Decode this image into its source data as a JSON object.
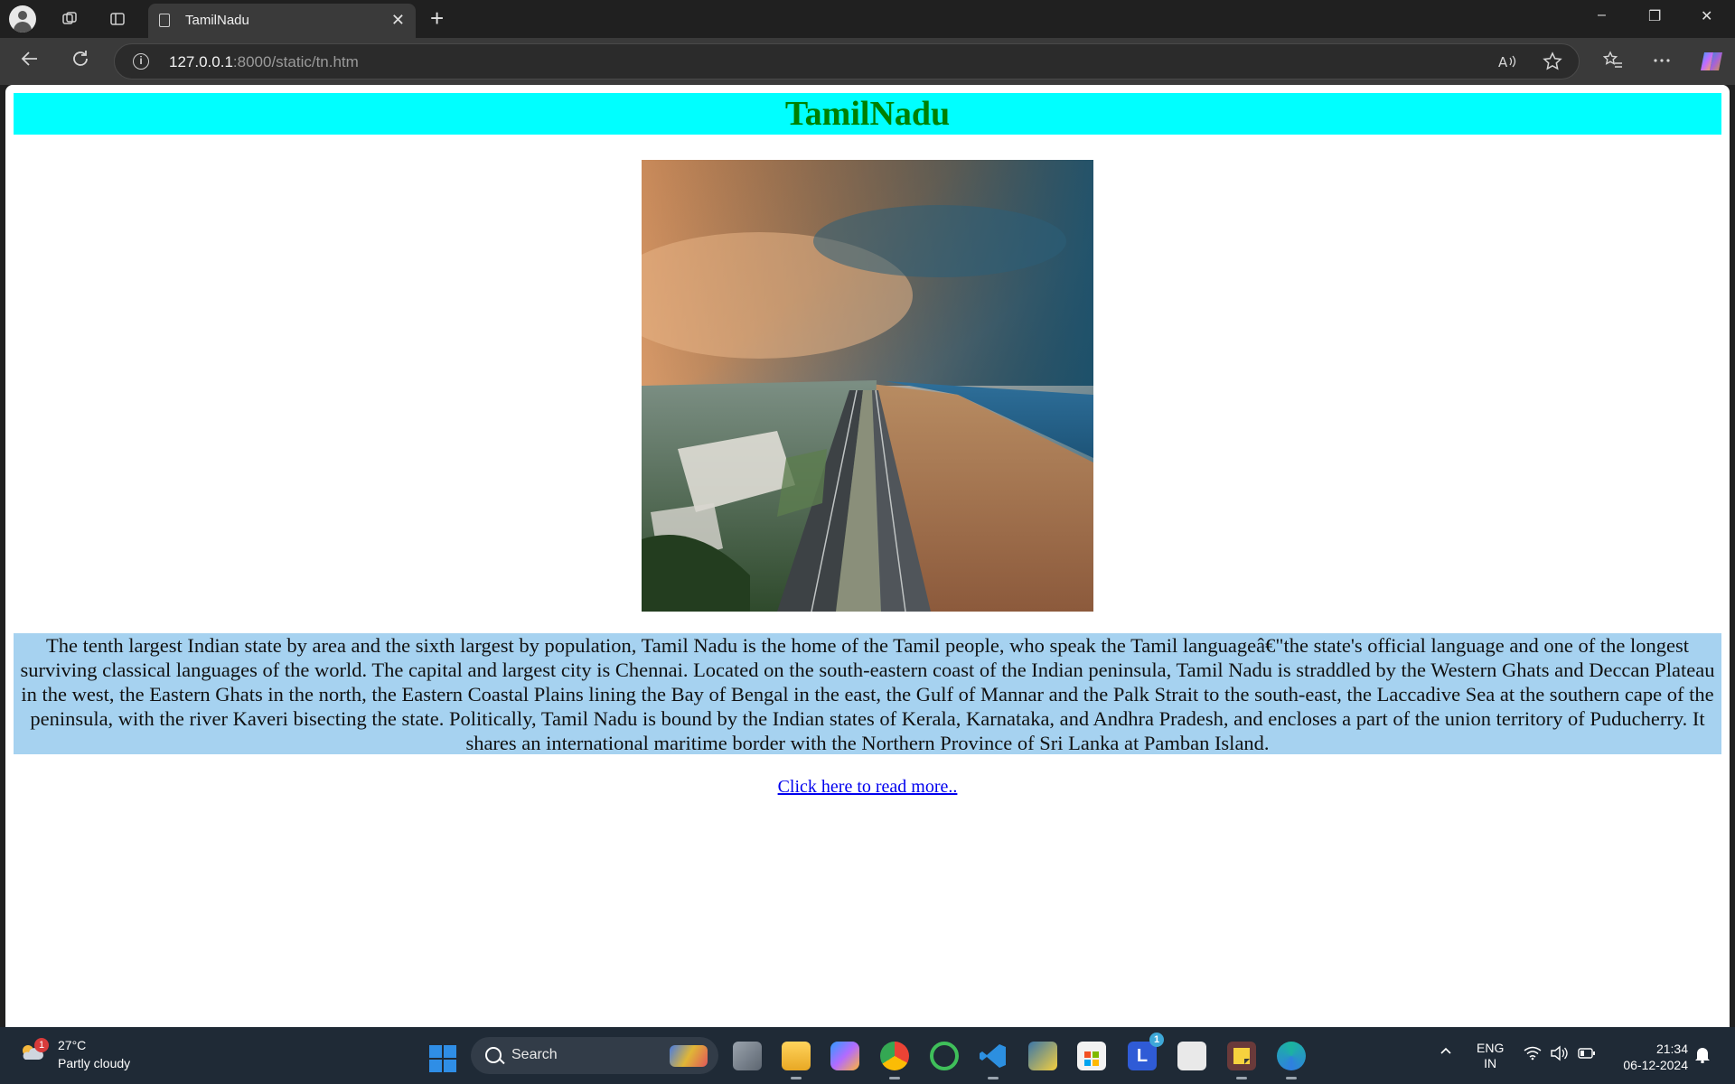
{
  "browser": {
    "tab_title": "TamilNadu",
    "tab_close": "✕",
    "new_tab": "+",
    "url_host": "127.0.0.1",
    "url_rest": ":8000/static/tn.htm",
    "window_buttons": [
      "–",
      "❐",
      "✕"
    ]
  },
  "page": {
    "heading": "TamilNadu",
    "image_alt": "Chennai Marina Beach aerial view",
    "description": "The tenth largest Indian state by area and the sixth largest by population, Tamil Nadu is the home of the Tamil people, who speak the Tamil languageâ€\"the state's official language and one of the longest surviving classical languages of the world. The capital and largest city is Chennai. Located on the south-eastern coast of the Indian peninsula, Tamil Nadu is straddled by the Western Ghats and Deccan Plateau in the west, the Eastern Ghats in the north, the Eastern Coastal Plains lining the Bay of Bengal in the east, the Gulf of Mannar and the Palk Strait to the south-east, the Laccadive Sea at the southern cape of the peninsula, with the river Kaveri bisecting the state. Politically, Tamil Nadu is bound by the Indian states of Kerala, Karnataka, and Andhra Pradesh, and encloses a part of the union territory of Puducherry. It shares an international maritime border with the Northern Province of Sri Lanka at Pamban Island.",
    "read_more": "Click here to read more.."
  },
  "taskbar": {
    "weather_temp": "27°C",
    "weather_condition": "Partly cloudy",
    "weather_badge": "1",
    "search_label": "Search",
    "lang_line1": "ENG",
    "lang_line2": "IN",
    "time": "21:34",
    "date": "06-12-2024",
    "app_badge": "1"
  },
  "colors": {
    "heading_bg": "#00ffff",
    "heading_text": "#008000",
    "desc_bg": "#a6d2f0",
    "link": "#0000ee"
  }
}
